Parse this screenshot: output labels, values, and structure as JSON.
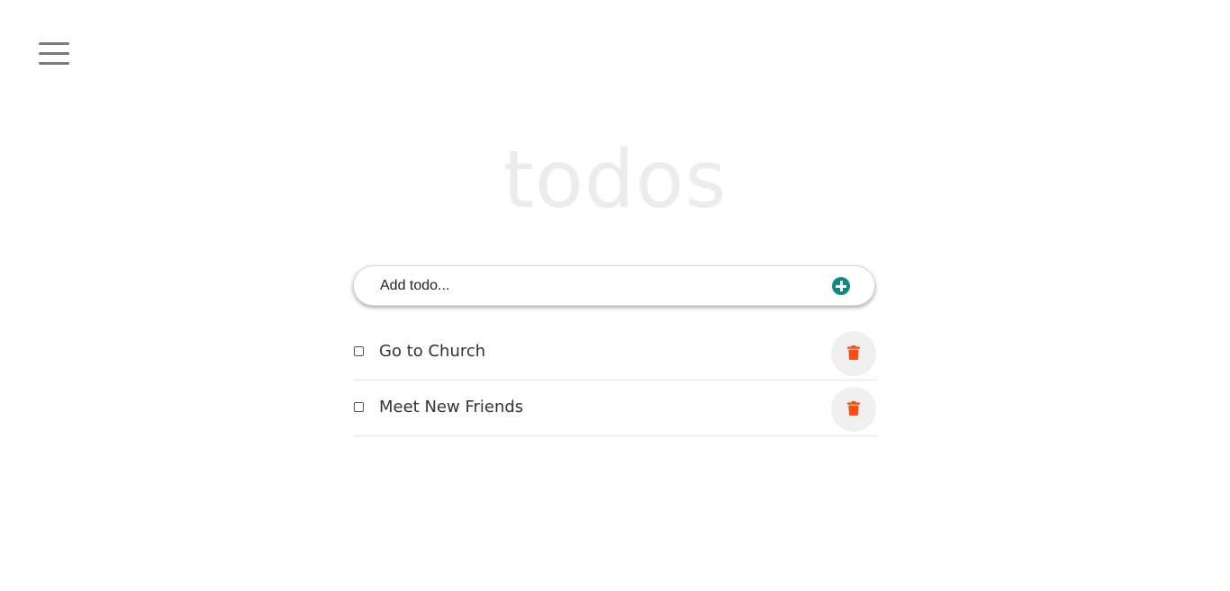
{
  "app": {
    "title": "todos"
  },
  "form": {
    "input_placeholder": "Add todo...",
    "input_value": "",
    "add_icon": "plus-circle-icon"
  },
  "todos": [
    {
      "text": "Go to Church",
      "completed": false
    },
    {
      "text": "Meet New Friends",
      "completed": false
    }
  ],
  "colors": {
    "accent": "#0f8a80",
    "delete": "#ff4a12",
    "title": "#ececec"
  }
}
